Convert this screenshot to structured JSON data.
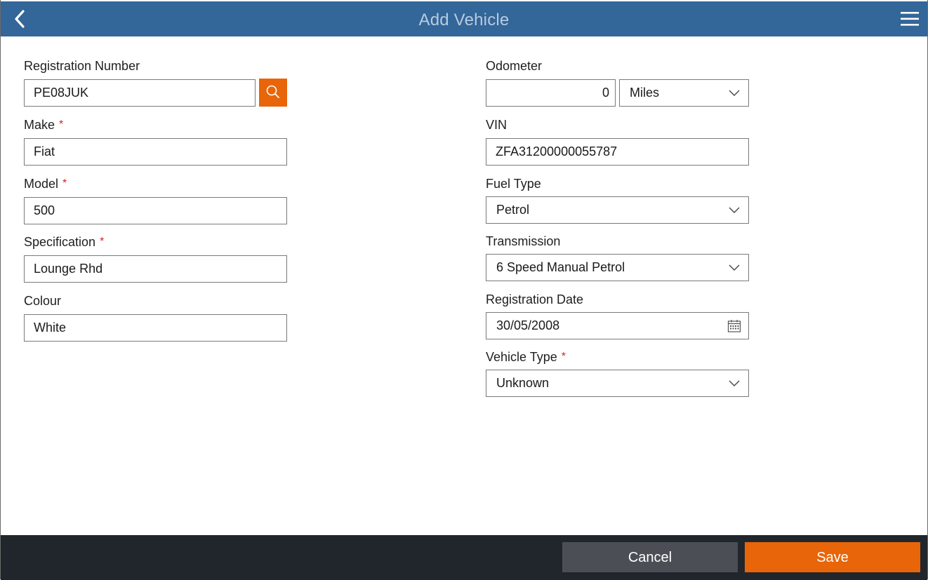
{
  "header": {
    "title": "Add Vehicle"
  },
  "form": {
    "registration": {
      "label": "Registration Number",
      "value": "PE08JUK"
    },
    "make": {
      "label": "Make",
      "value": "Fiat",
      "required": "*"
    },
    "model": {
      "label": "Model",
      "value": "500",
      "required": "*"
    },
    "specification": {
      "label": "Specification",
      "value": "Lounge Rhd",
      "required": "*"
    },
    "colour": {
      "label": "Colour",
      "value": "White"
    },
    "odometer": {
      "label": "Odometer",
      "value": "0",
      "unit": "Miles"
    },
    "vin": {
      "label": "VIN",
      "value": "ZFA31200000055787"
    },
    "fuel_type": {
      "label": "Fuel Type",
      "value": "Petrol"
    },
    "transmission": {
      "label": "Transmission",
      "value": "6 Speed Manual Petrol"
    },
    "registration_date": {
      "label": "Registration Date",
      "value": "30/05/2008"
    },
    "vehicle_type": {
      "label": "Vehicle Type",
      "value": "Unknown",
      "required": "*"
    }
  },
  "footer": {
    "cancel_label": "Cancel",
    "save_label": "Save"
  },
  "colors": {
    "header": "#336699",
    "accent": "#e8650a",
    "footer": "#21262c",
    "required": "#e02020"
  },
  "icons": {
    "back": "chevron-left-icon",
    "menu": "hamburger-menu-icon",
    "search": "search-icon",
    "dropdown": "chevron-down-icon",
    "date": "calendar-icon"
  }
}
